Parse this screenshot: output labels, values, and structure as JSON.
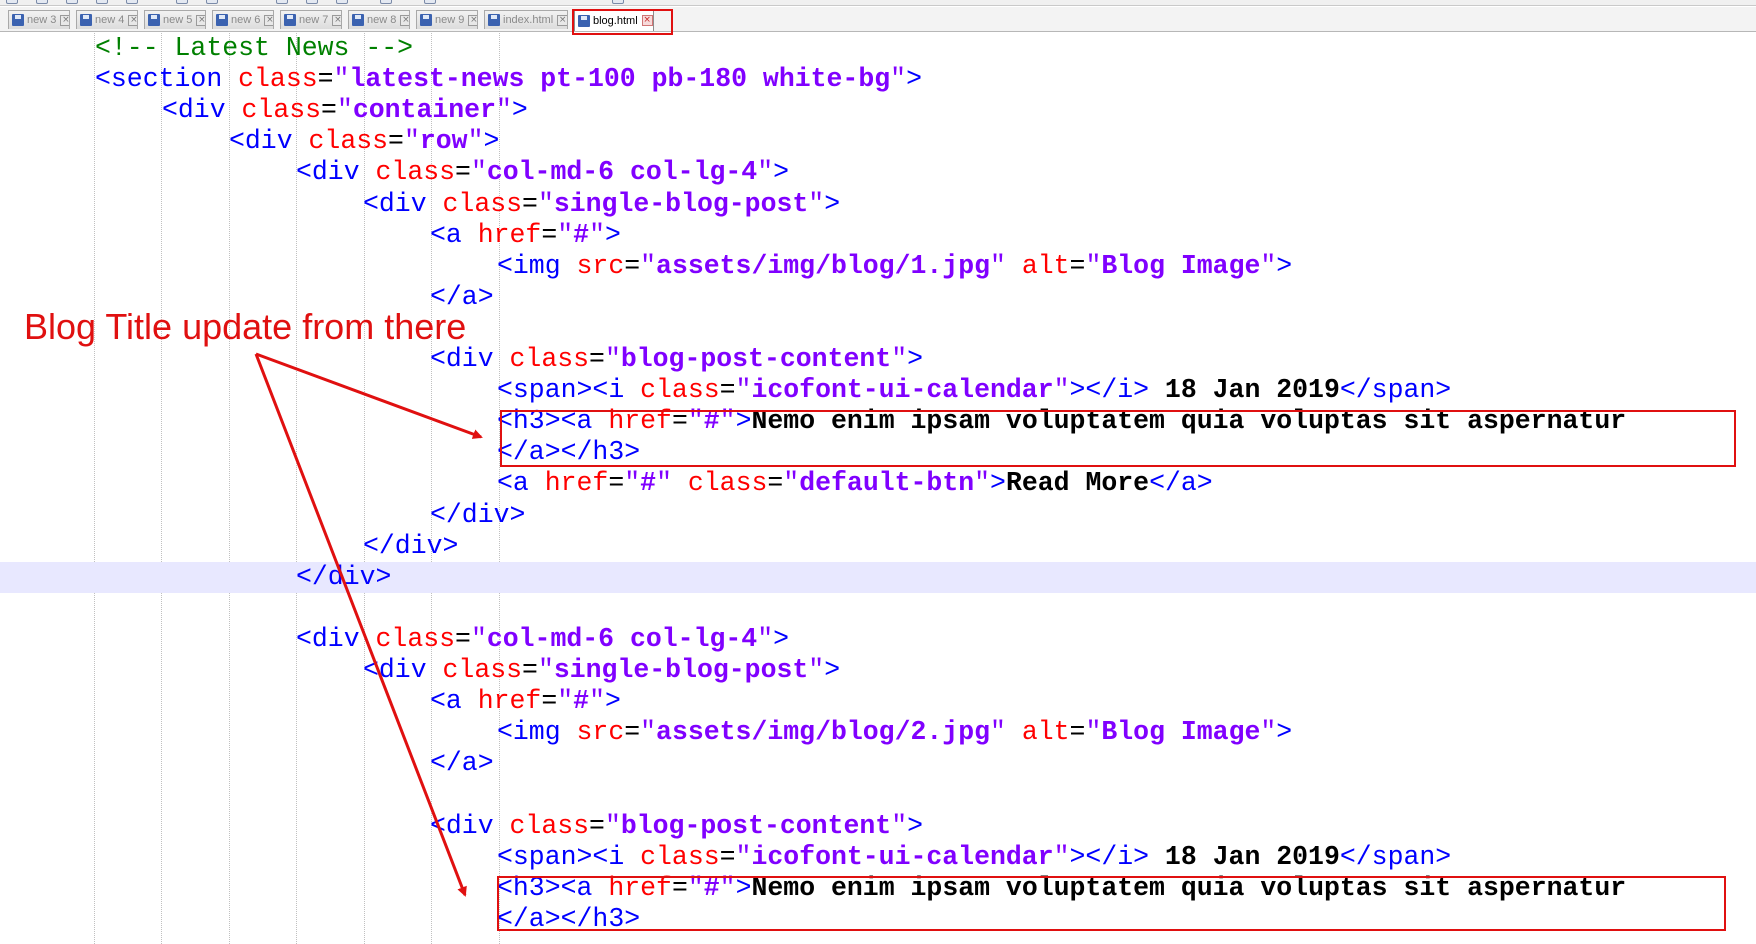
{
  "tabs": [
    {
      "label": "new 3",
      "active": false
    },
    {
      "label": "new 4",
      "active": false
    },
    {
      "label": "new 5",
      "active": false
    },
    {
      "label": "new 6",
      "active": false
    },
    {
      "label": "new 7",
      "active": false
    },
    {
      "label": "new 8",
      "active": false
    },
    {
      "label": "new 9",
      "active": false
    },
    {
      "label": "index.html",
      "active": false
    },
    {
      "label": "blog.html",
      "active": true
    }
  ],
  "lines": [
    {
      "indent": 1,
      "tokens": [
        [
          "cmt",
          "<!-- Latest News -->"
        ]
      ]
    },
    {
      "indent": 1,
      "tokens": [
        [
          "tag",
          "<section "
        ],
        [
          "attr",
          "class"
        ],
        [
          "eq",
          "="
        ],
        [
          "q",
          "\""
        ],
        [
          "val",
          "latest-news pt-100 pb-180 white-bg"
        ],
        [
          "q",
          "\""
        ],
        [
          "tag",
          ">"
        ]
      ]
    },
    {
      "indent": 2,
      "tokens": [
        [
          "tag",
          "<div "
        ],
        [
          "attr",
          "class"
        ],
        [
          "eq",
          "="
        ],
        [
          "q",
          "\""
        ],
        [
          "val",
          "container"
        ],
        [
          "q",
          "\""
        ],
        [
          "tag",
          ">"
        ]
      ]
    },
    {
      "indent": 3,
      "tokens": [
        [
          "tag",
          "<div "
        ],
        [
          "attr",
          "class"
        ],
        [
          "eq",
          "="
        ],
        [
          "q",
          "\""
        ],
        [
          "val",
          "row"
        ],
        [
          "q",
          "\""
        ],
        [
          "tag",
          ">"
        ]
      ]
    },
    {
      "indent": 4,
      "tokens": [
        [
          "tag",
          "<div "
        ],
        [
          "attr",
          "class"
        ],
        [
          "eq",
          "="
        ],
        [
          "q",
          "\""
        ],
        [
          "val",
          "col-md-6 col-lg-4"
        ],
        [
          "q",
          "\""
        ],
        [
          "tag",
          ">"
        ]
      ]
    },
    {
      "indent": 5,
      "tokens": [
        [
          "tag",
          "<div "
        ],
        [
          "attr",
          "class"
        ],
        [
          "eq",
          "="
        ],
        [
          "q",
          "\""
        ],
        [
          "val",
          "single-blog-post"
        ],
        [
          "q",
          "\""
        ],
        [
          "tag",
          ">"
        ]
      ]
    },
    {
      "indent": 6,
      "tokens": [
        [
          "tag",
          "<a "
        ],
        [
          "attr",
          "href"
        ],
        [
          "eq",
          "="
        ],
        [
          "q",
          "\""
        ],
        [
          "val",
          "#"
        ],
        [
          "q",
          "\""
        ],
        [
          "tag",
          ">"
        ]
      ]
    },
    {
      "indent": 7,
      "tokens": [
        [
          "tag",
          "<img "
        ],
        [
          "attr",
          "src"
        ],
        [
          "eq",
          "="
        ],
        [
          "q",
          "\""
        ],
        [
          "val",
          "assets/img/blog/1.jpg"
        ],
        [
          "q",
          "\""
        ],
        [
          "attr",
          " alt"
        ],
        [
          "eq",
          "="
        ],
        [
          "q",
          "\""
        ],
        [
          "val",
          "Blog Image"
        ],
        [
          "q",
          "\""
        ],
        [
          "tag",
          ">"
        ]
      ]
    },
    {
      "indent": 6,
      "tokens": [
        [
          "tag",
          "</a>"
        ]
      ]
    },
    {
      "indent": 0,
      "tokens": []
    },
    {
      "indent": 6,
      "tokens": [
        [
          "tag",
          "<div "
        ],
        [
          "attr",
          "class"
        ],
        [
          "eq",
          "="
        ],
        [
          "q",
          "\""
        ],
        [
          "val",
          "blog-post-content"
        ],
        [
          "q",
          "\""
        ],
        [
          "tag",
          ">"
        ]
      ]
    },
    {
      "indent": 7,
      "tokens": [
        [
          "tag",
          "<span><i "
        ],
        [
          "attr",
          "class"
        ],
        [
          "eq",
          "="
        ],
        [
          "q",
          "\""
        ],
        [
          "val",
          "icofont-ui-calendar"
        ],
        [
          "q",
          "\""
        ],
        [
          "tag",
          "></i>"
        ],
        [
          "txt",
          " 18 Jan 2019"
        ],
        [
          "tag",
          "</span>"
        ]
      ]
    },
    {
      "indent": 7,
      "tokens": [
        [
          "tag",
          "<h3><a "
        ],
        [
          "attr",
          "href"
        ],
        [
          "eq",
          "="
        ],
        [
          "q",
          "\""
        ],
        [
          "val",
          "#"
        ],
        [
          "q",
          "\""
        ],
        [
          "tag",
          ">"
        ],
        [
          "txt",
          "Nemo enim ipsam voluptatem quia voluptas sit aspernatur"
        ]
      ]
    },
    {
      "indent": 7,
      "tokens": [
        [
          "tag",
          "</a></h3>"
        ]
      ]
    },
    {
      "indent": 7,
      "tokens": [
        [
          "tag",
          "<a "
        ],
        [
          "attr",
          "href"
        ],
        [
          "eq",
          "="
        ],
        [
          "q",
          "\""
        ],
        [
          "val",
          "#"
        ],
        [
          "q",
          "\""
        ],
        [
          "attr",
          " class"
        ],
        [
          "eq",
          "="
        ],
        [
          "q",
          "\""
        ],
        [
          "val",
          "default-btn"
        ],
        [
          "q",
          "\""
        ],
        [
          "tag",
          ">"
        ],
        [
          "txt",
          "Read More"
        ],
        [
          "tag",
          "</a>"
        ]
      ]
    },
    {
      "indent": 6,
      "tokens": [
        [
          "tag",
          "</div>"
        ]
      ]
    },
    {
      "indent": 5,
      "tokens": [
        [
          "tag",
          "</div>"
        ]
      ]
    },
    {
      "indent": 4,
      "highlight": true,
      "tokens": [
        [
          "tag",
          "</div>"
        ]
      ]
    },
    {
      "indent": 0,
      "tokens": []
    },
    {
      "indent": 4,
      "tokens": [
        [
          "tag",
          "<div "
        ],
        [
          "attr",
          "class"
        ],
        [
          "eq",
          "="
        ],
        [
          "q",
          "\""
        ],
        [
          "val",
          "col-md-6 col-lg-4"
        ],
        [
          "q",
          "\""
        ],
        [
          "tag",
          ">"
        ]
      ]
    },
    {
      "indent": 5,
      "tokens": [
        [
          "tag",
          "<div "
        ],
        [
          "attr",
          "class"
        ],
        [
          "eq",
          "="
        ],
        [
          "q",
          "\""
        ],
        [
          "val",
          "single-blog-post"
        ],
        [
          "q",
          "\""
        ],
        [
          "tag",
          ">"
        ]
      ]
    },
    {
      "indent": 6,
      "tokens": [
        [
          "tag",
          "<a "
        ],
        [
          "attr",
          "href"
        ],
        [
          "eq",
          "="
        ],
        [
          "q",
          "\""
        ],
        [
          "val",
          "#"
        ],
        [
          "q",
          "\""
        ],
        [
          "tag",
          ">"
        ]
      ]
    },
    {
      "indent": 7,
      "tokens": [
        [
          "tag",
          "<img "
        ],
        [
          "attr",
          "src"
        ],
        [
          "eq",
          "="
        ],
        [
          "q",
          "\""
        ],
        [
          "val",
          "assets/img/blog/2.jpg"
        ],
        [
          "q",
          "\""
        ],
        [
          "attr",
          " alt"
        ],
        [
          "eq",
          "="
        ],
        [
          "q",
          "\""
        ],
        [
          "val",
          "Blog Image"
        ],
        [
          "q",
          "\""
        ],
        [
          "tag",
          ">"
        ]
      ]
    },
    {
      "indent": 6,
      "tokens": [
        [
          "tag",
          "</a>"
        ]
      ]
    },
    {
      "indent": 0,
      "tokens": []
    },
    {
      "indent": 6,
      "tokens": [
        [
          "tag",
          "<div "
        ],
        [
          "attr",
          "class"
        ],
        [
          "eq",
          "="
        ],
        [
          "q",
          "\""
        ],
        [
          "val",
          "blog-post-content"
        ],
        [
          "q",
          "\""
        ],
        [
          "tag",
          ">"
        ]
      ]
    },
    {
      "indent": 7,
      "tokens": [
        [
          "tag",
          "<span><i "
        ],
        [
          "attr",
          "class"
        ],
        [
          "eq",
          "="
        ],
        [
          "q",
          "\""
        ],
        [
          "val",
          "icofont-ui-calendar"
        ],
        [
          "q",
          "\""
        ],
        [
          "tag",
          "></i>"
        ],
        [
          "txt",
          " 18 Jan 2019"
        ],
        [
          "tag",
          "</span>"
        ]
      ]
    },
    {
      "indent": 7,
      "tokens": [
        [
          "tag",
          "<h3><a "
        ],
        [
          "attr",
          "href"
        ],
        [
          "eq",
          "="
        ],
        [
          "q",
          "\""
        ],
        [
          "val",
          "#"
        ],
        [
          "q",
          "\""
        ],
        [
          "tag",
          ">"
        ],
        [
          "txt",
          "Nemo enim ipsam voluptatem quia voluptas sit aspernatur"
        ]
      ]
    },
    {
      "indent": 7,
      "tokens": [
        [
          "tag",
          "</a></h3>"
        ]
      ]
    }
  ],
  "annotation": {
    "label": "Blog Title update from there",
    "color": "#e01010"
  },
  "colors": {
    "tag": "#0000ff",
    "attribute": "#ff0000",
    "value": "#8000ff",
    "comment": "#008000",
    "highlight_line": "#e8e8ff"
  }
}
